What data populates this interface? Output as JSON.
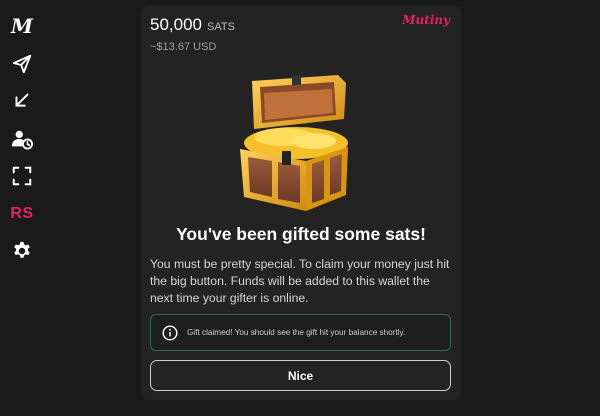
{
  "sidebar": {
    "items": [
      {
        "icon": "mutiny-m-logo",
        "text": "M"
      },
      {
        "icon": "send-icon"
      },
      {
        "icon": "receive-arrow-icon"
      },
      {
        "icon": "user-clock-icon"
      },
      {
        "icon": "scan-icon"
      },
      {
        "icon": "profile-initials",
        "text": "RS"
      },
      {
        "icon": "gear-icon"
      }
    ]
  },
  "card": {
    "amount": "50,000",
    "unit": "SATS",
    "usd": "~$13.67 USD",
    "brand": "Mutiny",
    "headline": "You've been gifted some sats!",
    "body": "You must be pretty special. To claim your money just hit the big button. Funds will be added to this wallet the next time your gifter is online.",
    "toast": "Gift claimed! You should see the gift hit your balance shortly.",
    "button_label": "Nice"
  },
  "colors": {
    "background": "#1a1a1a",
    "card": "#232323",
    "accent": "#e3235f",
    "toast_border": "#2e6b55"
  }
}
